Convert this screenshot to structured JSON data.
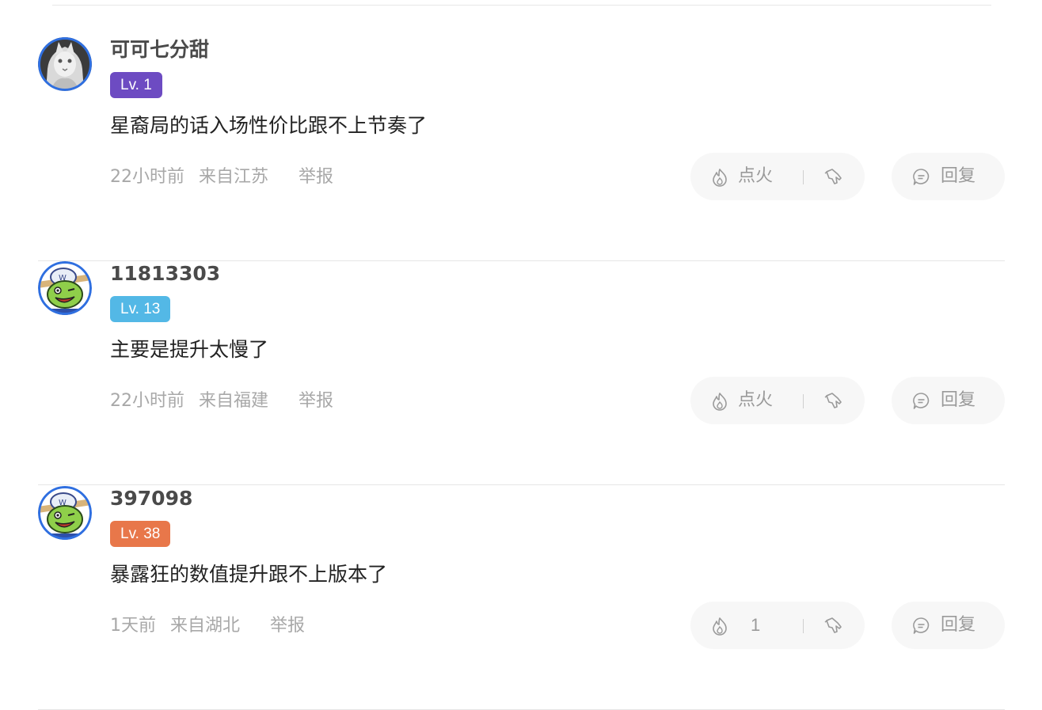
{
  "comments": [
    {
      "username": "可可七分甜",
      "level": "Lv. 1",
      "level_color": "#6d4bc2",
      "avatar": "white-cat-avatar-icon",
      "content": "星裔局的话入场性价比跟不上节奏了",
      "time": "22小时前",
      "location": "来自江苏",
      "report": "举报",
      "fire_label": "点火",
      "reply_label": "回复"
    },
    {
      "username": "11813303",
      "level": "Lv. 13",
      "level_color": "#53b8e6",
      "avatar": "frog-cartoon-avatar-icon",
      "content": "主要是提升太慢了",
      "time": "22小时前",
      "location": "来自福建",
      "report": "举报",
      "fire_label": "点火",
      "reply_label": "回复"
    },
    {
      "username": "397098",
      "level": "Lv. 38",
      "level_color": "#e8774a",
      "avatar": "frog-cartoon-avatar-icon",
      "content": "暴露狂的数值提升跟不上版本了",
      "time": "1天前",
      "location": "来自湖北",
      "report": "举报",
      "fire_count": "1",
      "reply_label": "回复"
    }
  ],
  "icons": {
    "fire": "fire-icon",
    "dislike": "thumb-down-icon",
    "reply": "comment-bubble-icon"
  }
}
